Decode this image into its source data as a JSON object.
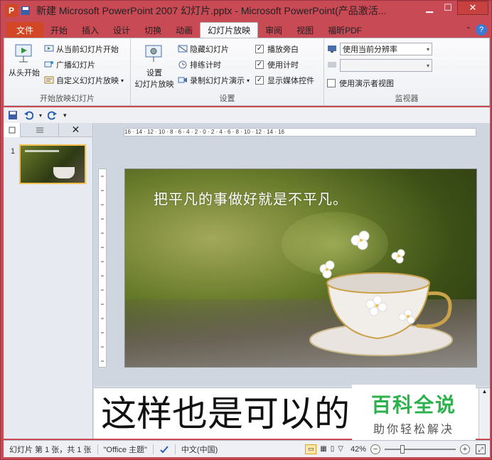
{
  "titlebar": {
    "title": "新建 Microsoft PowerPoint 2007 幻灯片.pptx - Microsoft PowerPoint(产品激活...",
    "app_letter": "P"
  },
  "tabs": {
    "file": "文件",
    "items": [
      "开始",
      "插入",
      "设计",
      "切换",
      "动画",
      "幻灯片放映",
      "审阅",
      "视图",
      "福昕PDF"
    ],
    "active": "幻灯片放映",
    "help": "?"
  },
  "ribbon": {
    "group_start": {
      "label": "开始放映幻灯片",
      "from_beginning": "从头开始",
      "from_current": "从当前幻灯片开始",
      "broadcast": "广播幻灯片",
      "custom": "自定义幻灯片放映"
    },
    "group_setup": {
      "label": "设置",
      "setup_line1": "设置",
      "setup_line2": "幻灯片放映",
      "hide_slide": "隐藏幻灯片",
      "rehearse": "排练计时",
      "record": "录制幻灯片演示",
      "play_narration": "播放旁白",
      "use_timings": "使用计时",
      "show_media": "显示媒体控件"
    },
    "group_monitor": {
      "label": "监视器",
      "resolution": "使用当前分辨率",
      "monitor_select": "",
      "presenter_view": "使用演示者视图"
    }
  },
  "thumbs": {
    "slide_number": "1"
  },
  "slide": {
    "text": "把平凡的事做好就是不平凡。"
  },
  "hruler_text": "16 · 14 · 12 · 10 · 8 · 6 · 4 · 2 · 0 · 2 · 4 · 6 · 8 · 10 · 12 · 14 · 16",
  "notes": {
    "text": "这样也是可以的"
  },
  "watermark": {
    "line1": "百科全说",
    "line2": "助你轻松解决"
  },
  "status": {
    "slide_info": "幻灯片 第 1 张，共 1 张",
    "theme": "\"Office 主题\"",
    "language": "中文(中国)",
    "zoom": "42%"
  },
  "colors": {
    "accent": "#d24726",
    "frame": "#c84a55",
    "watermark_green": "#2bb24c"
  }
}
